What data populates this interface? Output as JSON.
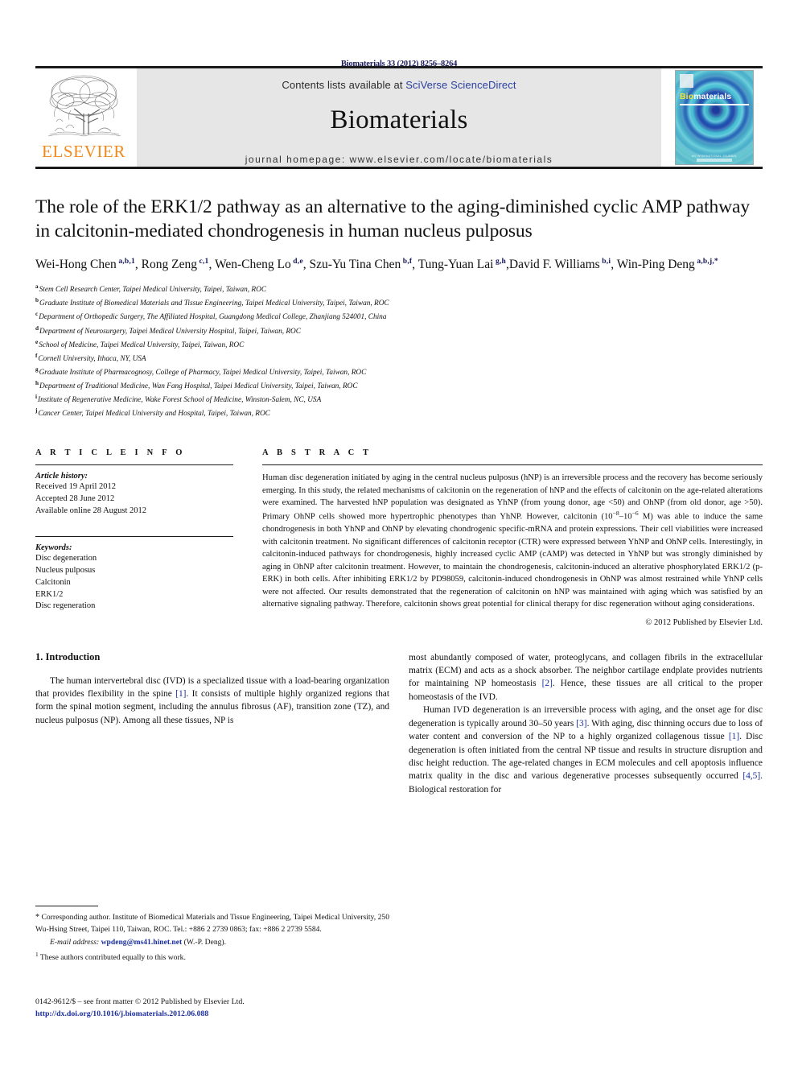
{
  "running_head": "Biomaterials 33 (2012) 8256–8264",
  "masthead": {
    "contents_prefix": "Contents lists available at ",
    "sciverse_link": "SciVerse ScienceDirect",
    "journal_title": "Biomaterials",
    "homepage": "journal homepage: www.elsevier.com/locate/biomaterials",
    "publisher_wordmark": "ELSEVIER",
    "cover": {
      "title_part1": "Bio",
      "title_part2": "materials",
      "footer_text": "AN INTERNATIONAL JOURNAL"
    },
    "accent_orange": "#f08a1c",
    "link_blue": "#2a3fa0",
    "band_gray": "#e6e6e6"
  },
  "article": {
    "title": "The role of the ERK1/2 pathway as an alternative to the aging-diminished cyclic AMP pathway in calcitonin-mediated chondrogenesis in human nucleus pulposus",
    "authors": [
      {
        "name": "Wei-Hong Chen",
        "sup": "a,b,1",
        "sep": ", "
      },
      {
        "name": "Rong Zeng",
        "sup": "c,1",
        "sep": ", "
      },
      {
        "name": "Wen-Cheng Lo",
        "sup": "d,e",
        "sep": ", "
      },
      {
        "name": "Szu-Yu Tina Chen",
        "sup": "b,f",
        "sep": ", "
      },
      {
        "name": "Tung-Yuan Lai",
        "sup": "g,h",
        "sep": ","
      },
      {
        "name": "David F. Williams",
        "sup": "b,i",
        "sep": ", "
      },
      {
        "name": "Win-Ping Deng",
        "sup": "a,b,j,*",
        "sep": ""
      }
    ],
    "affiliations": [
      {
        "marker": "a",
        "text": "Stem Cell Research Center, Taipei Medical University, Taipei, Taiwan, ROC"
      },
      {
        "marker": "b",
        "text": "Graduate Institute of Biomedical Materials and Tissue Engineering, Taipei Medical University, Taipei, Taiwan, ROC"
      },
      {
        "marker": "c",
        "text": "Department of Orthopedic Surgery, The Affiliated Hospital, Guangdong Medical College, Zhanjiang 524001, China"
      },
      {
        "marker": "d",
        "text": "Department of Neurosurgery, Taipei Medical University Hospital, Taipei, Taiwan, ROC"
      },
      {
        "marker": "e",
        "text": "School of Medicine, Taipei Medical University, Taipei, Taiwan, ROC"
      },
      {
        "marker": "f",
        "text": "Cornell University, Ithaca, NY, USA"
      },
      {
        "marker": "g",
        "text": "Graduate Institute of Pharmacognosy, College of Pharmacy, Taipei Medical University, Taipei, Taiwan, ROC"
      },
      {
        "marker": "h",
        "text": "Department of Traditional Medicine, Wan Fang Hospital, Taipei Medical University, Taipei, Taiwan, ROC"
      },
      {
        "marker": "i",
        "text": "Institute of Regenerative Medicine, Wake Forest School of Medicine, Winston-Salem, NC, USA"
      },
      {
        "marker": "j",
        "text": "Cancer Center, Taipei Medical University and Hospital, Taipei, Taiwan, ROC"
      }
    ]
  },
  "article_info": {
    "heading": "A R T I C L E   I N F O",
    "history_label": "Article history:",
    "history": [
      "Received 19 April 2012",
      "Accepted 28 June 2012",
      "Available online 28 August 2012"
    ],
    "keywords_label": "Keywords:",
    "keywords": [
      "Disc degeneration",
      "Nucleus pulposus",
      "Calcitonin",
      "ERK1/2",
      "Disc regeneration"
    ]
  },
  "abstract": {
    "heading": "A B S T R A C T",
    "part1": "Human disc degeneration initiated by aging in the central nucleus pulposus (hNP) is an irreversible process and the recovery has become seriously emerging. In this study, the related mechanisms of calcitonin on the regeneration of hNP and the effects of calcitonin on the age-related alterations were examined. The harvested hNP population was designated as YhNP (from young donor, age <50) and OhNP (from old donor, age >50). Primary OhNP cells showed more hypertrophic phenotypes than YhNP. However, calcitonin (10",
    "exp1": "−8",
    "mid1": "–10",
    "exp2": "−6",
    "part2": " M) was able to induce the same chondrogenesis in both YhNP and OhNP by elevating chondrogenic specific-mRNA and protein expressions. Their cell viabilities were increased with calcitonin treatment. No significant differences of calcitonin receptor (CTR) were expressed between YhNP and OhNP cells. Interestingly, in calcitonin-induced pathways for chondrogenesis, highly increased cyclic AMP (cAMP) was detected in YhNP but was strongly diminished by aging in OhNP after calcitonin treatment. However, to maintain the chondrogenesis, calcitonin-induced an alterative phosphorylated ERK1/2 (p-ERK) in both cells. After inhibiting ERK1/2 by PD98059, calcitonin-induced chondrogenesis in OhNP was almost restrained while YhNP cells were not affected. Our results demonstrated that the regeneration of calcitonin on hNP was maintained with aging which was satisfied by an alternative signaling pathway. Therefore, calcitonin shows great potential for clinical therapy for disc regeneration without aging considerations.",
    "copyright": "© 2012 Published by Elsevier Ltd."
  },
  "introduction": {
    "section_number_title": "1.  Introduction",
    "left_para1_a": "The human intervertebral disc (IVD) is a specialized tissue with a load-bearing organization that provides flexibility in the spine ",
    "left_ref1": "[1]",
    "left_para1_b": ". It consists of multiple highly organized regions that form the spinal motion segment, including the annulus fibrosus (AF), transition zone (TZ), and nucleus pulposus (NP). Among all these tissues, NP is",
    "right_para1_a": "most abundantly composed of water, proteoglycans, and collagen fibrils in the extracellular matrix (ECM) and acts as a shock absorber. The neighbor cartilage endplate provides nutrients for maintaining NP homeostasis ",
    "right_ref2": "[2]",
    "right_para1_b": ". Hence, these tissues are all critical to the proper homeostasis of the IVD.",
    "right_para2_a": "Human IVD degeneration is an irreversible process with aging, and the onset age for disc degeneration is typically around 30–50 years ",
    "right_ref3": "[3]",
    "right_para2_b": ". With aging, disc thinning occurs due to loss of water content and conversion of the NP to a highly organized collagenous tissue ",
    "right_ref4": "[1]",
    "right_para2_c": ". Disc degeneration is often initiated from the central NP tissue and results in structure disruption and disc height reduction. The age-related changes in ECM molecules and cell apoptosis influence matrix quality in the disc and various degenerative processes subsequently occurred ",
    "right_ref5": "[4,5]",
    "right_para2_d": ". Biological restoration for"
  },
  "footnotes": {
    "corresponding_star": "*",
    "corresponding": " Corresponding author. Institute of Biomedical Materials and Tissue Engineering, Taipei Medical University, 250 Wu-Hsing Street, Taipei 110, Taiwan, ROC. Tel.: +886 2 2739 0863; fax: +886 2 2739 5584.",
    "email_label": "E-mail address:",
    "email": "wpdeng@ms41.hinet.net",
    "email_suffix": " (W.-P. Deng).",
    "equal_marker": "1",
    "equal_contrib": " These authors contributed equally to this work."
  },
  "imprint": {
    "front_matter": "0142-9612/$ – see front matter © 2012 Published by Elsevier Ltd.",
    "doi": "http://dx.doi.org/10.1016/j.biomaterials.2012.06.088"
  }
}
